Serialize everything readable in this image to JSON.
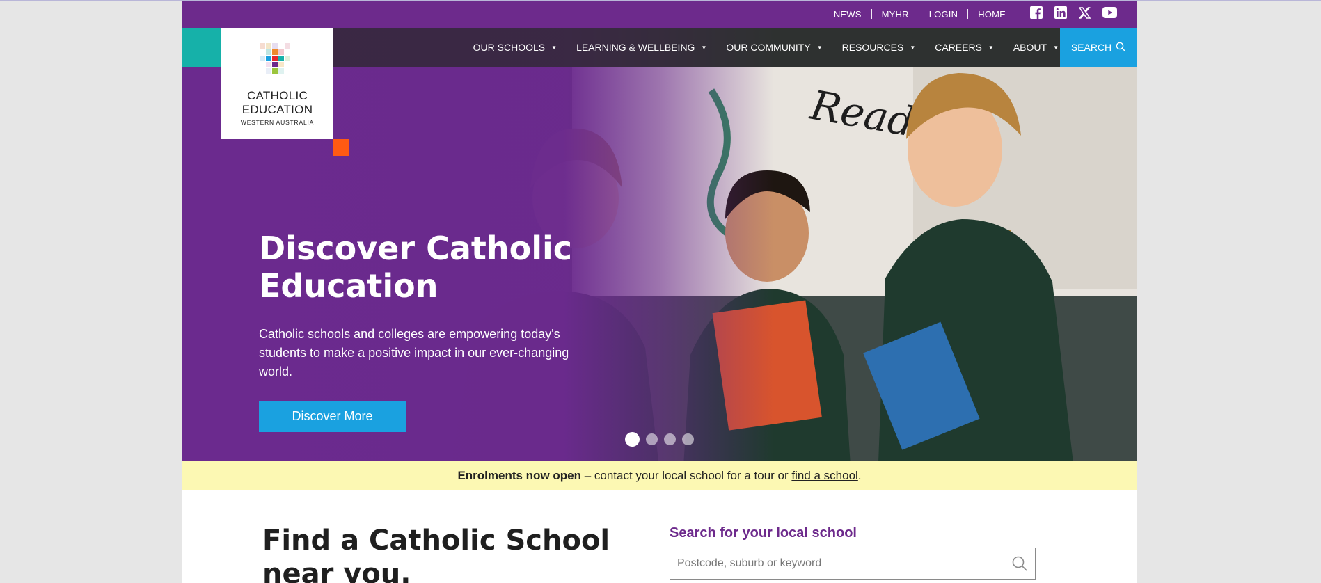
{
  "utility": {
    "links": [
      "NEWS",
      "MYHR",
      "LOGIN",
      "HOME"
    ],
    "social": [
      "facebook-icon",
      "linkedin-icon",
      "x-icon",
      "youtube-icon"
    ]
  },
  "nav": {
    "items": [
      "OUR SCHOOLS",
      "LEARNING & WELLBEING",
      "OUR COMMUNITY",
      "RESOURCES",
      "CAREERS",
      "ABOUT"
    ],
    "search_label": "SEARCH"
  },
  "logo": {
    "line1": "CATHOLIC",
    "line2": "EDUCATION",
    "line3": "WESTERN AUSTRALIA"
  },
  "hero": {
    "title": "Discover Catholic Education",
    "subtitle": "Catholic schools and colleges are empowering today's students to make a positive impact in our ever-changing world.",
    "button": "Discover More",
    "slides_total": 4,
    "active_slide": 1
  },
  "banner": {
    "bold": "Enrolments now open",
    "text": " – contact your local school for a tour or ",
    "link": "find a school",
    "end": "."
  },
  "find": {
    "title": "Find a Catholic School near you.",
    "search_label": "Search for your local school",
    "placeholder": "Postcode, suburb or keyword"
  },
  "colors": {
    "purple": "#6d2a8c",
    "teal": "#16b1a9",
    "blue": "#1aa1e0",
    "orange": "#ff5a13",
    "banner": "#fcf8b3"
  }
}
